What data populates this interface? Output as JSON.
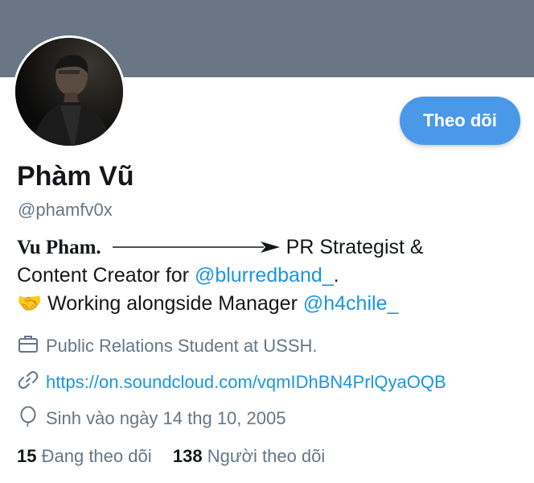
{
  "profile": {
    "follow_button": "Theo dõi",
    "name": "Phàm Vũ",
    "handle": "@phamfv0x"
  },
  "bio": {
    "line1_bold": "Vu Pham.",
    "line1_rest": "PR Strategist &",
    "line2_text": "Content Creator for ",
    "line2_mention": "@blurredband_",
    "line2_end": ".",
    "line3_emoji": "🤝",
    "line3_text": " Working alongside Manager ",
    "line3_mention": "@h4chile_"
  },
  "meta": {
    "job": "Public Relations Student at USSH.",
    "url": "https://on.soundcloud.com/vqmIDhBN4PrlQyaOQB",
    "birthday": "Sinh vào ngày 14 thg 10, 2005"
  },
  "stats": {
    "following_count": "15",
    "following_label": "Đang theo dõi",
    "followers_count": "138",
    "followers_label": "Người theo dõi"
  },
  "colors": {
    "banner": "#6a7684",
    "accent": "#1b95e0",
    "button": "#4a99e9",
    "secondary_text": "#657786"
  }
}
